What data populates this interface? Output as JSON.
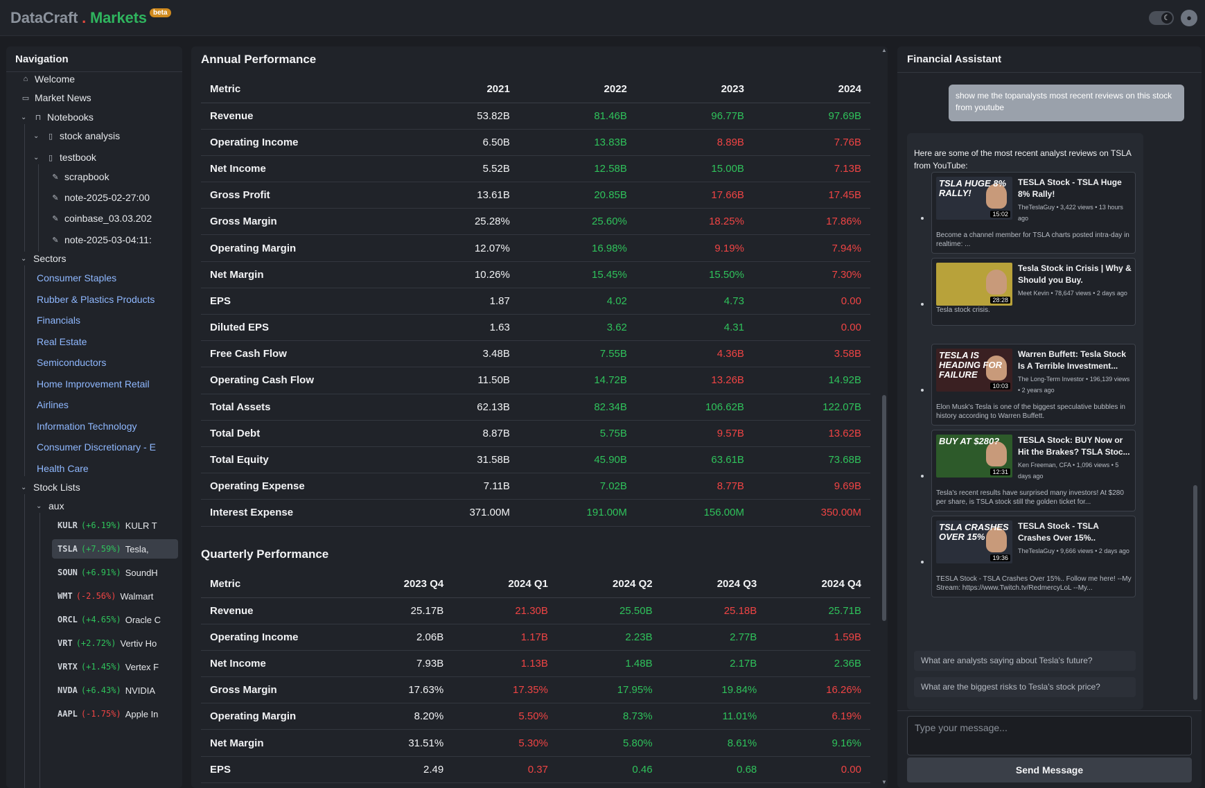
{
  "header": {
    "brand_part1": "DataCraft",
    "brand_dot": ".",
    "brand_part2": "Markets",
    "badge": "beta",
    "theme_icon": "moon-icon",
    "user_icon": "user-icon"
  },
  "colors": {
    "positive": "#2fc25b",
    "negative": "#ef4444",
    "brand": "#2fb45e",
    "link": "#8fb8ff"
  },
  "sidebar": {
    "title": "Navigation",
    "welcome": "Welcome",
    "market_news": "Market News",
    "notebooks": "Notebooks",
    "stock_analysis": "stock analysis",
    "testbook": "testbook",
    "notes": [
      "scrapbook",
      "note-2025-02-27:00",
      "coinbase_03.03.202",
      "note-2025-03-04:11:"
    ],
    "sectors_label": "Sectors",
    "sectors": [
      "Consumer Staples",
      "Rubber & Plastics Products",
      "Financials",
      "Real Estate",
      "Semiconductors",
      "Home Improvement Retail",
      "Airlines",
      "Information Technology",
      "Consumer Discretionary - E",
      "Health Care"
    ],
    "stock_lists_label": "Stock Lists",
    "aux_label": "aux",
    "stocks": [
      {
        "ticker": "KULR",
        "change": "(+6.19%)",
        "name": "KULR T",
        "dir": "up"
      },
      {
        "ticker": "TSLA",
        "change": "(+7.59%)",
        "name": "Tesla,",
        "dir": "up"
      },
      {
        "ticker": "SOUN",
        "change": "(+6.91%)",
        "name": "SoundH",
        "dir": "up"
      },
      {
        "ticker": "WMT",
        "change": "(-2.56%)",
        "name": "Walmart",
        "dir": "dn"
      },
      {
        "ticker": "ORCL",
        "change": "(+4.65%)",
        "name": "Oracle C",
        "dir": "up"
      },
      {
        "ticker": "VRT",
        "change": "(+2.72%)",
        "name": "Vertiv Ho",
        "dir": "up"
      },
      {
        "ticker": "VRTX",
        "change": "(+1.45%)",
        "name": "Vertex F",
        "dir": "up"
      },
      {
        "ticker": "NVDA",
        "change": "(+6.43%)",
        "name": "NVIDIA",
        "dir": "up"
      },
      {
        "ticker": "AAPL",
        "change": "(-1.75%)",
        "name": "Apple In",
        "dir": "dn"
      }
    ]
  },
  "annual": {
    "title": "Annual Performance",
    "headers": [
      "Metric",
      "2021",
      "2022",
      "2023",
      "2024"
    ],
    "rows": [
      {
        "metric": "Revenue",
        "values": [
          "53.82B",
          "81.46B",
          "96.77B",
          "97.69B"
        ],
        "dirs": [
          "base",
          "up",
          "up",
          "up"
        ]
      },
      {
        "metric": "Operating Income",
        "values": [
          "6.50B",
          "13.83B",
          "8.89B",
          "7.76B"
        ],
        "dirs": [
          "base",
          "up",
          "dn",
          "dn"
        ]
      },
      {
        "metric": "Net Income",
        "values": [
          "5.52B",
          "12.58B",
          "15.00B",
          "7.13B"
        ],
        "dirs": [
          "base",
          "up",
          "up",
          "dn"
        ]
      },
      {
        "metric": "Gross Profit",
        "values": [
          "13.61B",
          "20.85B",
          "17.66B",
          "17.45B"
        ],
        "dirs": [
          "base",
          "up",
          "dn",
          "dn"
        ]
      },
      {
        "metric": "Gross Margin",
        "values": [
          "25.28%",
          "25.60%",
          "18.25%",
          "17.86%"
        ],
        "dirs": [
          "base",
          "up",
          "dn",
          "dn"
        ]
      },
      {
        "metric": "Operating Margin",
        "values": [
          "12.07%",
          "16.98%",
          "9.19%",
          "7.94%"
        ],
        "dirs": [
          "base",
          "up",
          "dn",
          "dn"
        ]
      },
      {
        "metric": "Net Margin",
        "values": [
          "10.26%",
          "15.45%",
          "15.50%",
          "7.30%"
        ],
        "dirs": [
          "base",
          "up",
          "up",
          "dn"
        ]
      },
      {
        "metric": "EPS",
        "values": [
          "1.87",
          "4.02",
          "4.73",
          "0.00"
        ],
        "dirs": [
          "base",
          "up",
          "up",
          "dn"
        ]
      },
      {
        "metric": "Diluted EPS",
        "values": [
          "1.63",
          "3.62",
          "4.31",
          "0.00"
        ],
        "dirs": [
          "base",
          "up",
          "up",
          "dn"
        ]
      },
      {
        "metric": "Free Cash Flow",
        "values": [
          "3.48B",
          "7.55B",
          "4.36B",
          "3.58B"
        ],
        "dirs": [
          "base",
          "up",
          "dn",
          "dn"
        ]
      },
      {
        "metric": "Operating Cash Flow",
        "values": [
          "11.50B",
          "14.72B",
          "13.26B",
          "14.92B"
        ],
        "dirs": [
          "base",
          "up",
          "dn",
          "up"
        ]
      },
      {
        "metric": "Total Assets",
        "values": [
          "62.13B",
          "82.34B",
          "106.62B",
          "122.07B"
        ],
        "dirs": [
          "base",
          "up",
          "up",
          "up"
        ]
      },
      {
        "metric": "Total Debt",
        "values": [
          "8.87B",
          "5.75B",
          "9.57B",
          "13.62B"
        ],
        "dirs": [
          "base",
          "up",
          "dn",
          "dn"
        ]
      },
      {
        "metric": "Total Equity",
        "values": [
          "31.58B",
          "45.90B",
          "63.61B",
          "73.68B"
        ],
        "dirs": [
          "base",
          "up",
          "up",
          "up"
        ]
      },
      {
        "metric": "Operating Expense",
        "values": [
          "7.11B",
          "7.02B",
          "8.77B",
          "9.69B"
        ],
        "dirs": [
          "base",
          "up",
          "dn",
          "dn"
        ]
      },
      {
        "metric": "Interest Expense",
        "values": [
          "371.00M",
          "191.00M",
          "156.00M",
          "350.00M"
        ],
        "dirs": [
          "base",
          "up",
          "up",
          "dn"
        ]
      }
    ]
  },
  "quarterly": {
    "title": "Quarterly Performance",
    "headers": [
      "Metric",
      "2023 Q4",
      "2024 Q1",
      "2024 Q2",
      "2024 Q3",
      "2024 Q4"
    ],
    "rows": [
      {
        "metric": "Revenue",
        "values": [
          "25.17B",
          "21.30B",
          "25.50B",
          "25.18B",
          "25.71B"
        ],
        "dirs": [
          "base",
          "dn",
          "up",
          "dn",
          "up"
        ]
      },
      {
        "metric": "Operating Income",
        "values": [
          "2.06B",
          "1.17B",
          "2.23B",
          "2.77B",
          "1.59B"
        ],
        "dirs": [
          "base",
          "dn",
          "up",
          "up",
          "dn"
        ]
      },
      {
        "metric": "Net Income",
        "values": [
          "7.93B",
          "1.13B",
          "1.48B",
          "2.17B",
          "2.36B"
        ],
        "dirs": [
          "base",
          "dn",
          "up",
          "up",
          "up"
        ]
      },
      {
        "metric": "Gross Margin",
        "values": [
          "17.63%",
          "17.35%",
          "17.95%",
          "19.84%",
          "16.26%"
        ],
        "dirs": [
          "base",
          "dn",
          "up",
          "up",
          "dn"
        ]
      },
      {
        "metric": "Operating Margin",
        "values": [
          "8.20%",
          "5.50%",
          "8.73%",
          "11.01%",
          "6.19%"
        ],
        "dirs": [
          "base",
          "dn",
          "up",
          "up",
          "dn"
        ]
      },
      {
        "metric": "Net Margin",
        "values": [
          "31.51%",
          "5.30%",
          "5.80%",
          "8.61%",
          "9.16%"
        ],
        "dirs": [
          "base",
          "dn",
          "up",
          "up",
          "up"
        ]
      },
      {
        "metric": "EPS",
        "values": [
          "2.49",
          "0.37",
          "0.46",
          "0.68",
          "0.00"
        ],
        "dirs": [
          "base",
          "dn",
          "up",
          "up",
          "dn"
        ]
      }
    ]
  },
  "assistant": {
    "title": "Financial Assistant",
    "user_message": "show me the topanalysts most recent reviews on this stock from youtube",
    "bot_intro": "Here are some of the most recent analyst reviews on TSLA from YouTube:",
    "videos": [
      {
        "thumb_text": "TSLA HUGE 8% RALLY!",
        "duration": "15:02",
        "title": "TESLA Stock - TSLA Huge 8% Rally!",
        "meta": "TheTeslaGuy • 3,422 views • 13 hours ago",
        "desc": "Become a channel member for TSLA charts posted intra-day in realtime: ...",
        "bg": "#2a2f3a"
      },
      {
        "thumb_text": "",
        "duration": "28:28",
        "title": "Tesla Stock in Crisis | Why & Should you Buy.",
        "meta": "Meet Kevin • 78,647 views • 2 days ago",
        "desc": "Tesla stock crisis.",
        "bg": "#b8a23a"
      },
      {
        "thumb_text": "TESLA IS HEADING FOR FAILURE",
        "duration": "10:03",
        "title": "Warren Buffett: Tesla Stock Is A Terrible Investment...",
        "meta": "The Long-Term Investor • 196,139 views • 2 years ago",
        "desc": "Elon Musk's Tesla is one of the biggest speculative bubbles in history according to Warren Buffett.",
        "bg": "#3a2022"
      },
      {
        "thumb_text": "BUY AT $280?",
        "duration": "12:31",
        "title": "TESLA Stock: BUY Now or Hit the Brakes? TSLA Stoc...",
        "meta": "Ken Freeman, CFA • 1,096 views • 5 days ago",
        "desc": "Tesla's recent results have surprised many investors! At $280 per share, is TSLA stock still the golden ticket for...",
        "bg": "#2d5a2a"
      },
      {
        "thumb_text": "TSLA CRASHES OVER 15%",
        "duration": "19:36",
        "title": "TESLA Stock - TSLA Crashes Over 15%..",
        "meta": "TheTeslaGuy • 9,666 views • 2 days ago",
        "desc": "TESLA Stock - TSLA Crashes Over 15%.. Follow me here! --My Stream: https://www.Twitch.tv/RedmercyLoL --My...",
        "bg": "#2a2f3a"
      }
    ],
    "suggestions": [
      "What are analysts saying about Tesla's future?",
      "What are the biggest risks to Tesla's stock price?"
    ],
    "input_placeholder": "Type your message...",
    "send_label": "Send Message"
  }
}
